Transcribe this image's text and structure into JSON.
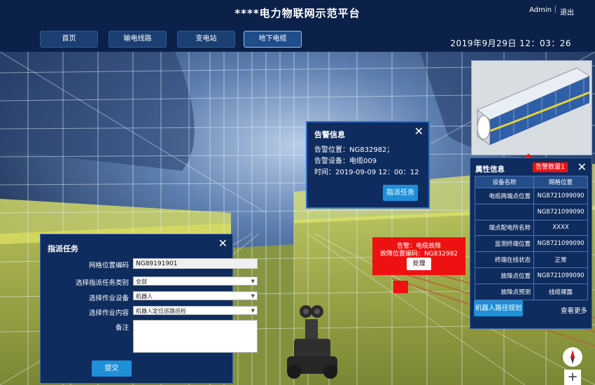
{
  "header": {
    "title": "****电力物联网示范平台",
    "user": "Admin",
    "separator": "|",
    "logout": "退出"
  },
  "nav": {
    "items": [
      "首页",
      "输电线路",
      "变电站",
      "地下电缆"
    ],
    "active_index": 3
  },
  "datetime": "2019年9月29日    12：03：26",
  "alarm_popup": {
    "title": "告警信息",
    "location": "告警位置：NG832982；",
    "device": "告警设备：电缆009",
    "time": "时间：2019-09-09 12：00：12",
    "dispatch_button": "指派任务"
  },
  "task_panel": {
    "title": "指派任务",
    "fields": [
      {
        "label": "网格位置编码",
        "value": "NG89191901"
      },
      {
        "label": "选择指派任务类别",
        "value": "全部"
      },
      {
        "label": "选择作业设备",
        "value": "机器人"
      },
      {
        "label": "选择作业内容",
        "value": "机器人定位巡路巡检"
      },
      {
        "label": "备注",
        "value": ""
      }
    ],
    "submit": "提交"
  },
  "red_alert": {
    "line1": "告警：电缆故障",
    "line2": "故障位置编码：NG832982",
    "button": "处理"
  },
  "attr_panel": {
    "title": "属性信息",
    "alarm_count": "告警数量1",
    "headers": [
      "设备名称",
      "网格位置"
    ],
    "rows": [
      [
        "电缆两端点位置",
        "NG8721099090"
      ],
      [
        "",
        "NG8721099090"
      ],
      [
        "端点配电所名称",
        "XXXX"
      ],
      [
        "监测终端位置",
        "NG8721099090"
      ],
      [
        "终端在线状态",
        "正常"
      ],
      [
        "故障点位置",
        "NG8721099090"
      ],
      [
        "故障点预测",
        "线缆裸露"
      ]
    ],
    "robot_button": "机器人路径规划",
    "more": "查看更多"
  },
  "map_tools": {
    "compass": "compass-icon",
    "zoom_in": "+"
  },
  "colors": {
    "header_bg": "#0b2149",
    "panel_bg": "#0e2c5e",
    "alert_red": "#ee1111",
    "button_blue": "#1f8fd8",
    "mesh_yellow": "#d4d84a"
  }
}
